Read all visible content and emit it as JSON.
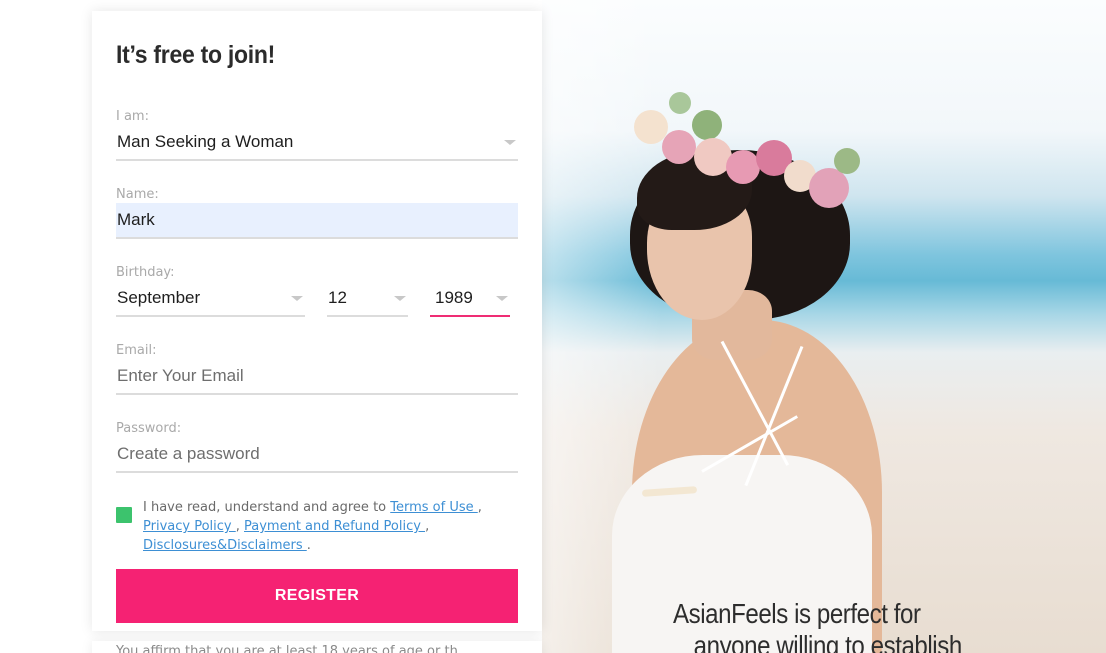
{
  "signup": {
    "title": "It’s free to join!",
    "iam": {
      "label": "I am:",
      "value": "Man Seeking a Woman"
    },
    "name": {
      "label": "Name:",
      "value": "Mark"
    },
    "birthday": {
      "label": "Birthday:",
      "month": "September",
      "day": "12",
      "year": "1989"
    },
    "email": {
      "label": "Email:",
      "placeholder": "Enter Your Email"
    },
    "password": {
      "label": "Password:",
      "placeholder": "Create a password"
    },
    "consent": {
      "prefix": "I have read, understand and agree to ",
      "terms": "Terms of Use ",
      "privacy": "Privacy Policy ",
      "refund": "Payment and Refund Policy ",
      "disclosures": "Disclosures&Disclaimers ",
      "checked": true
    },
    "register_label": "REGISTER",
    "footnote": "You affirm that you are at least 18 years of age or th"
  },
  "hero": {
    "caption_line1": "AsianFeels is perfect for",
    "caption_line2": "anyone willing to establish"
  },
  "colors": {
    "accent": "#f52273",
    "checkbox": "#3cc36d",
    "link": "#3d8fd4",
    "active_underline": "#ef2d74"
  },
  "icons": {
    "select_caret": "chevron-down-icon",
    "checkbox": "checkbox-checked-icon"
  }
}
